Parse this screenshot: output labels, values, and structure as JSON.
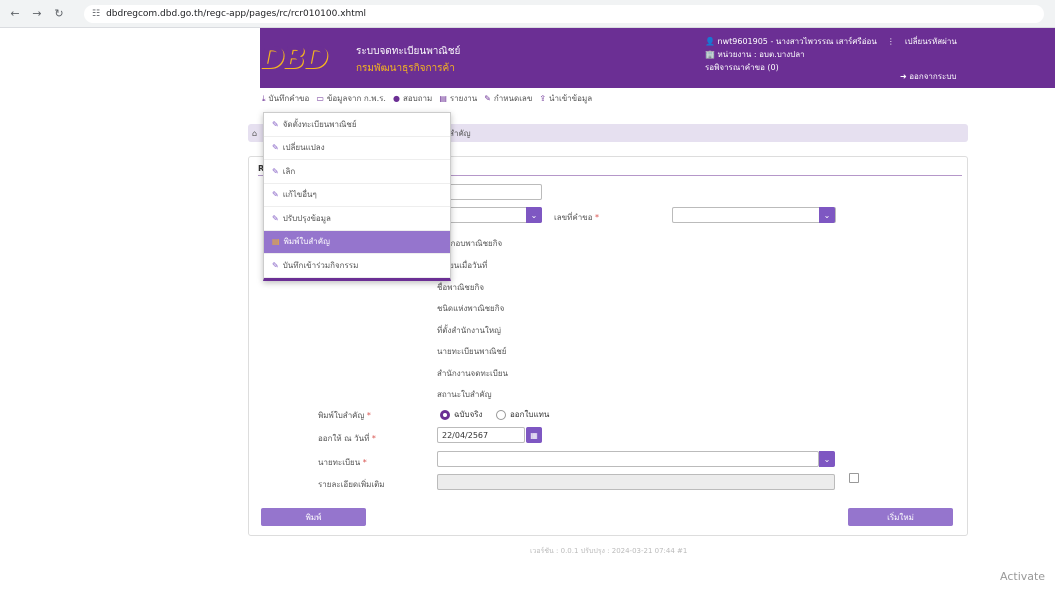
{
  "browser": {
    "url": "dbdregcom.dbd.go.th/regc-app/pages/rc/rcr010100.xhtml"
  },
  "header": {
    "logo": "DBD",
    "system_name": "ระบบจดทะเบียนพาณิชย์",
    "department": "กรมพัฒนาธุรกิจการค้า",
    "user": "nwt9601905 - นางสาวไพวรรณ เสาร์ศรีอ่อน",
    "change_password": "เปลี่ยนรหัสผ่าน",
    "unit": "หน่วยงาน : อบต.บางปลา",
    "pending": "รอพิจารณาคำขอ (0)",
    "logout": "ออกจากระบบ"
  },
  "menu": [
    {
      "icon": "download-icon",
      "label": "บันทึกคำขอ"
    },
    {
      "icon": "monitor-icon",
      "label": "ข้อมูลจาก ก.พ.ร."
    },
    {
      "icon": "chat-icon",
      "label": "สอบถาม"
    },
    {
      "icon": "report-icon",
      "label": "รายงาน"
    },
    {
      "icon": "edit-icon",
      "label": "กำหนดเลข"
    },
    {
      "icon": "import-icon",
      "label": "นำเข้าข้อมูล"
    }
  ],
  "dropdown": [
    {
      "label": "จัดตั้งทะเบียนพาณิชย์",
      "active": false
    },
    {
      "label": "เปลี่ยนแปลง",
      "active": false
    },
    {
      "label": "เลิก",
      "active": false
    },
    {
      "label": "แก้ไขอื่นๆ",
      "active": false
    },
    {
      "label": "ปรับปรุงข้อมูล",
      "active": false
    },
    {
      "label": "พิมพ์ใบสำคัญ",
      "active": true
    },
    {
      "label": "บันทึกเข้าร่วมกิจกรรม",
      "active": false
    }
  ],
  "breadcrumb": "สำคัญ",
  "form": {
    "tab_initial": "R",
    "request_no_label": "เลขที่คำขอ",
    "info_labels": [
      "ประกอบพาณิชยกิจ",
      "ะเบียนเมื่อวันที่",
      "ชื่อพาณิชยกิจ",
      "ชนิดแห่งพาณิชยกิจ",
      "ที่ตั้งสำนักงานใหญ่",
      "นายทะเบียนพาณิชย์",
      "สำนักงานจดทะเบียน",
      "สถานะใบสำคัญ"
    ],
    "print_label": "พิมพ์ใบสำคัญ",
    "print_opt_original": "ฉบับจริง",
    "print_opt_copy": "ออกใบแทน",
    "issue_date_label": "ออกให้ ณ วันที่",
    "issue_date_value": "22/04/2567",
    "registrar_label": "นายทะเบียน",
    "details_label": "รายละเอียดเพิ่มเติม",
    "print_button": "พิมพ์",
    "reset_button": "เริ่มใหม่"
  },
  "version": "เวอร์ชัน : 0.0.1 ปรับปรุง : 2024-03-21 07:44 #1",
  "activate": "Activate",
  "colors": {
    "primary": "#6b2f94",
    "accent": "#f5b51f",
    "button": "#9575cd"
  }
}
